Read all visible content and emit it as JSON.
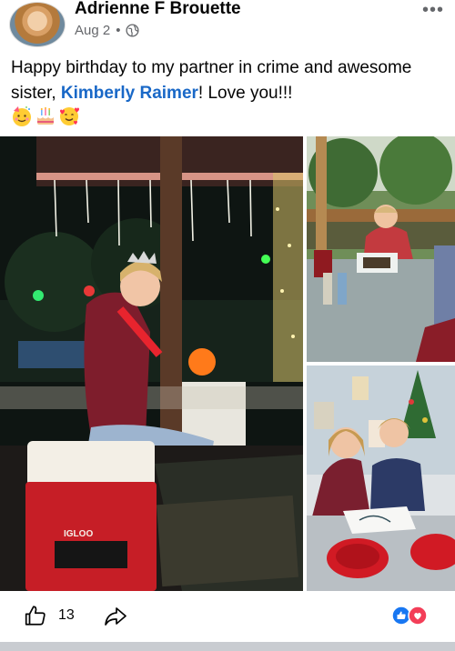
{
  "post": {
    "author": "Adrienne F Brouette",
    "date": "Aug 2",
    "separator": "•",
    "text_before": "Happy birthday to my partner in crime and awesome sister,",
    "mention": "Kimberly Raimer",
    "text_after": "! Love you!!!",
    "emojis": [
      "partying-face",
      "birthday-cake",
      "smiling-face-with-hearts"
    ],
    "privacy_icon": "globe-icon",
    "menu_icon": "more-icon"
  },
  "photos": {
    "count": 3,
    "cooler_text": "IGLOO"
  },
  "actions": {
    "like_count": "13",
    "like_icon": "thumbs-up-icon",
    "share_icon": "share-arrow-icon",
    "reactions": [
      "like",
      "love"
    ]
  },
  "colors": {
    "mention": "#1968c7",
    "meta": "#65676b",
    "like_reaction": "#1877f2",
    "love_reaction": "#f33e58",
    "divider": "#c9ccd1"
  }
}
